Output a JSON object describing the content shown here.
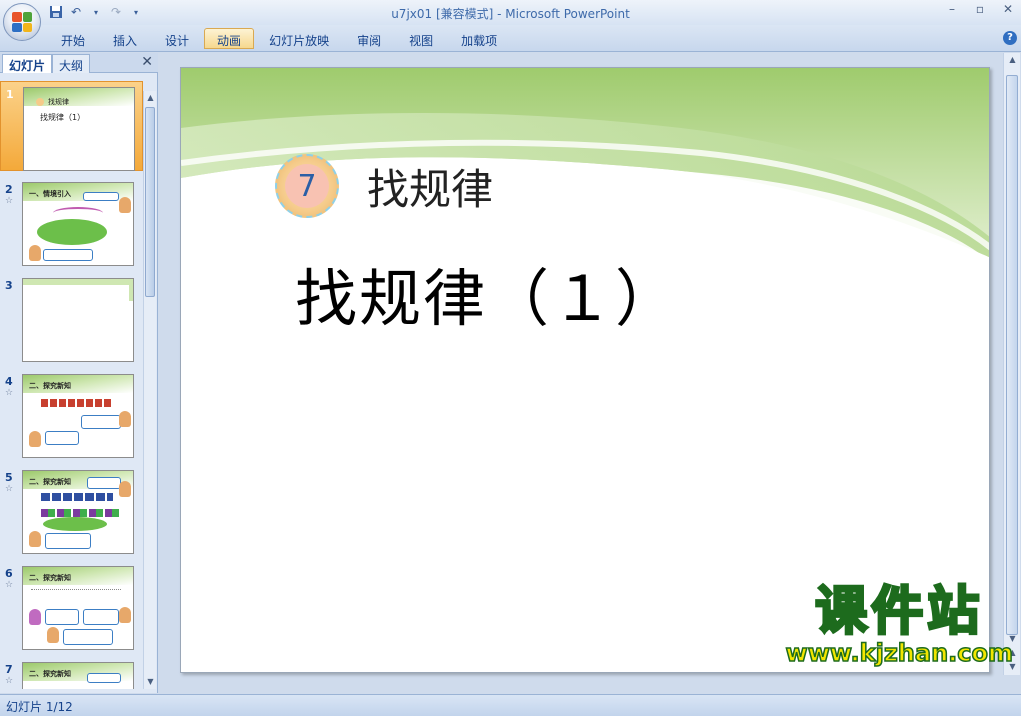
{
  "window": {
    "title": "u7jx01 [兼容模式]",
    "separator": " - ",
    "app": "Microsoft PowerPoint"
  },
  "ribbon": {
    "tabs": [
      {
        "label": "开始"
      },
      {
        "label": "插入"
      },
      {
        "label": "设计"
      },
      {
        "label": "动画",
        "active": true
      },
      {
        "label": "幻灯片放映"
      },
      {
        "label": "审阅"
      },
      {
        "label": "视图"
      },
      {
        "label": "加载项"
      }
    ]
  },
  "panel": {
    "tab_slides": "幻灯片",
    "tab_outline": "大纲",
    "thumbs": [
      {
        "num": "1",
        "title": "找规律",
        "subtitle": "找规律（1）"
      },
      {
        "num": "2",
        "title": "一、情境引入"
      },
      {
        "num": "3"
      },
      {
        "num": "4",
        "title": "二、探究新知"
      },
      {
        "num": "5",
        "title": "二、探究新知"
      },
      {
        "num": "6",
        "title": "二、探究新知"
      },
      {
        "num": "7",
        "title": "二、探究新知"
      }
    ],
    "anim_marker": "☆"
  },
  "slide": {
    "badge_number": "7",
    "header": "找规律",
    "title": "找规律（１）"
  },
  "watermark": {
    "name": "课件站",
    "url": "www.kjzhan.com"
  },
  "status": {
    "slide_indicator": "幻灯片 1/12"
  },
  "colors": {
    "accent_tab": "#f6d88e",
    "selected_thumb": "#f4a93a",
    "slide_green": "#9cc96b",
    "badge_blue": "#2b5fa6"
  }
}
